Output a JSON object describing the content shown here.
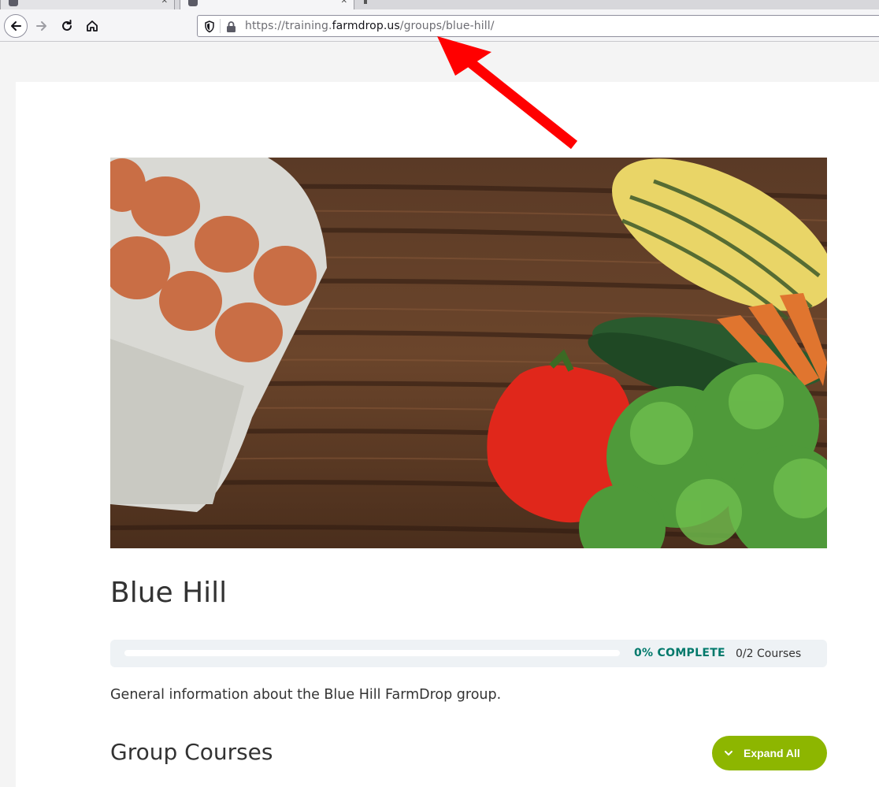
{
  "browser": {
    "url_prefix": "https://training.",
    "url_domain": "farmdrop.us",
    "url_path": "/groups/blue-hill/"
  },
  "page": {
    "title": "Blue Hill",
    "progress": {
      "percent": 0,
      "label": "0% COMPLETE",
      "courses": "0/2 Courses"
    },
    "description": "General information about the Blue Hill FarmDrop group.",
    "courses_heading": "Group Courses",
    "expand_all_label": "Expand All"
  },
  "colors": {
    "accent_teal": "#00796b",
    "button_green": "#8db600",
    "annotation_arrow": "#ff0000"
  }
}
